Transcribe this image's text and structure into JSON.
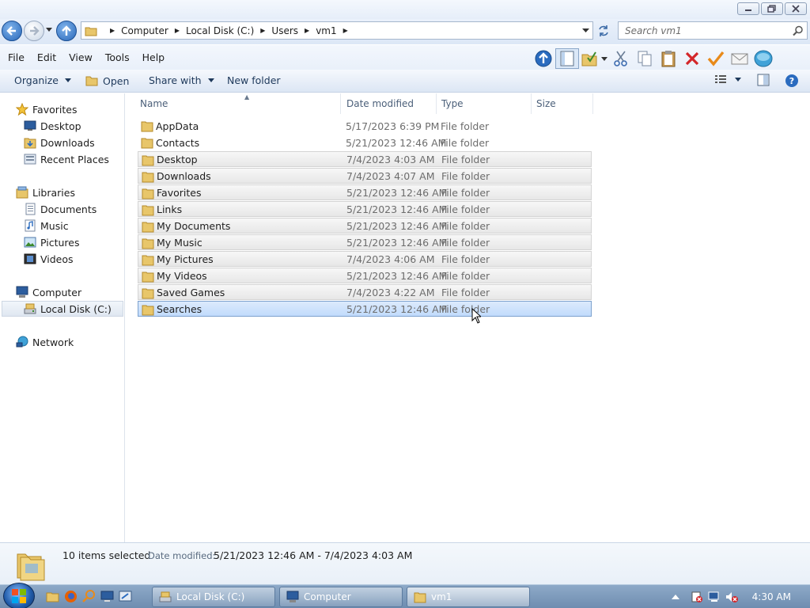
{
  "window": {
    "minimize_icon": "minimize-icon",
    "maximize_icon": "restore-icon",
    "close_icon": "close-icon"
  },
  "address": {
    "crumbs": [
      "Computer",
      "Local Disk (C:)",
      "Users",
      "vm1"
    ],
    "search_placeholder": "Search vm1"
  },
  "menu": {
    "items": [
      "File",
      "Edit",
      "View",
      "Tools",
      "Help"
    ]
  },
  "commands": {
    "organize": "Organize",
    "open": "Open",
    "share_with": "Share with",
    "new_folder": "New folder"
  },
  "nav": {
    "favorites": "Favorites",
    "desktop": "Desktop",
    "downloads": "Downloads",
    "recent_places": "Recent Places",
    "libraries": "Libraries",
    "documents": "Documents",
    "music": "Music",
    "pictures": "Pictures",
    "videos": "Videos",
    "computer": "Computer",
    "local_disk": "Local Disk (C:)",
    "network": "Network"
  },
  "columns": {
    "name": "Name",
    "date_modified": "Date modified",
    "type": "Type",
    "size": "Size"
  },
  "files": [
    {
      "name": "AppData",
      "date": "5/17/2023 6:39 PM",
      "type": "File folder",
      "state": "normal"
    },
    {
      "name": "Contacts",
      "date": "5/21/2023 12:46 AM",
      "type": "File folder",
      "state": "normal"
    },
    {
      "name": "Desktop",
      "date": "7/4/2023 4:03 AM",
      "type": "File folder",
      "state": "selected"
    },
    {
      "name": "Downloads",
      "date": "7/4/2023 4:07 AM",
      "type": "File folder",
      "state": "selected"
    },
    {
      "name": "Favorites",
      "date": "5/21/2023 12:46 AM",
      "type": "File folder",
      "state": "selected"
    },
    {
      "name": "Links",
      "date": "5/21/2023 12:46 AM",
      "type": "File folder",
      "state": "selected"
    },
    {
      "name": "My Documents",
      "date": "5/21/2023 12:46 AM",
      "type": "File folder",
      "state": "selected"
    },
    {
      "name": "My Music",
      "date": "5/21/2023 12:46 AM",
      "type": "File folder",
      "state": "selected"
    },
    {
      "name": "My Pictures",
      "date": "7/4/2023 4:06 AM",
      "type": "File folder",
      "state": "selected"
    },
    {
      "name": "My Videos",
      "date": "5/21/2023 12:46 AM",
      "type": "File folder",
      "state": "selected"
    },
    {
      "name": "Saved Games",
      "date": "7/4/2023 4:22 AM",
      "type": "File folder",
      "state": "selected"
    },
    {
      "name": "Searches",
      "date": "5/21/2023 12:46 AM",
      "type": "File folder",
      "state": "focus"
    }
  ],
  "details": {
    "count": "10 items selected",
    "date_label": "Date modified:",
    "date_value": "5/21/2023 12:46 AM - 7/4/2023 4:03 AM"
  },
  "taskbar": {
    "tasks": [
      "Local Disk (C:)",
      "Computer",
      "vm1"
    ],
    "clock": "4:30 AM"
  },
  "colors": {
    "selection": "#e7e7e7",
    "focus": "#c1dbfc",
    "taskbar": "#7f9cbd"
  }
}
